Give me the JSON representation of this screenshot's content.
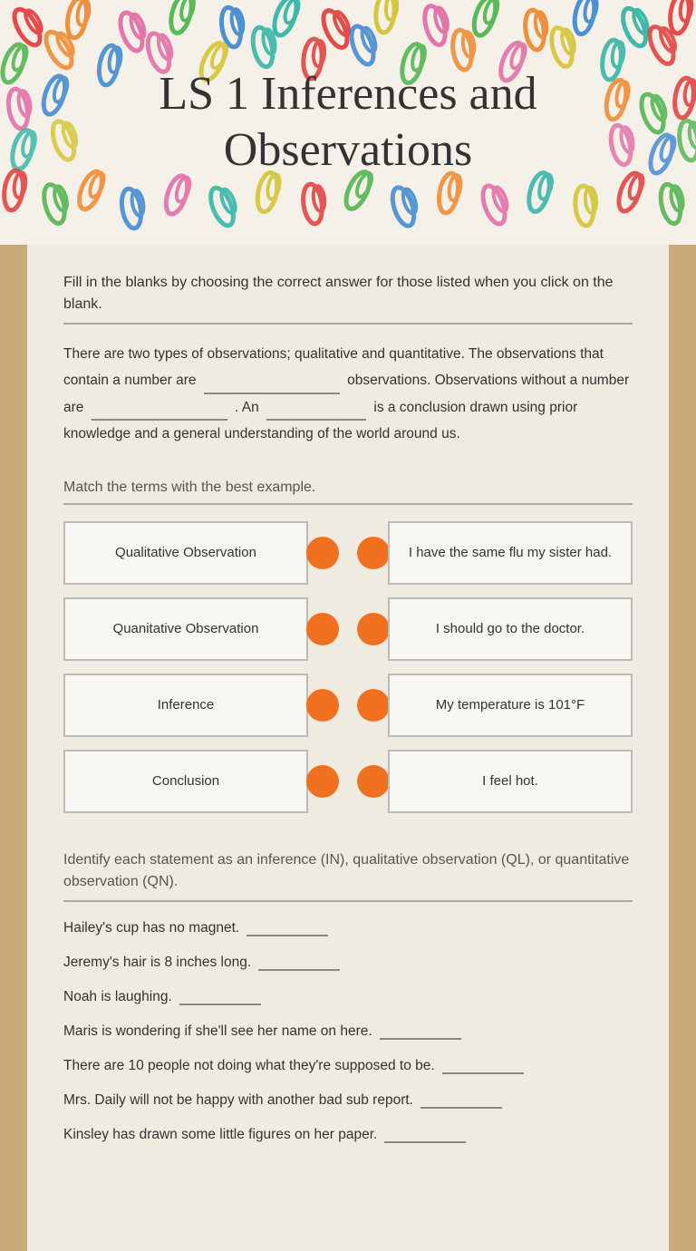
{
  "header": {
    "title": "LS 1 Inferences and Observations"
  },
  "section1": {
    "instructions": "Fill in the blanks by choosing the correct answer for those listed when you click on the blank.",
    "paragraph": "There are two types of observations; qualitative and quantitative. The observations that contain a number are",
    "part2": "observations. Observations without a number are",
    "part3": ". An",
    "part4": "is a conclusion drawn using prior knowledge and a general understanding of the world around us."
  },
  "section2": {
    "instructions": "Match the terms with the best example.",
    "left_items": [
      "Qualitative Observation",
      "Quanitative Observation",
      "Inference",
      "Conclusion"
    ],
    "right_items": [
      "I have the same flu my sister had.",
      "I should go to the doctor.",
      "My temperature is 101°F",
      "I feel hot."
    ]
  },
  "section3": {
    "instructions": "Identify each statement as an inference (IN), qualitative observation (QL), or quantitative observation (QN).",
    "items": [
      "Hailey's cup has no magnet.",
      "Jeremy's hair is 8 inches long.",
      "Noah is laughing.",
      "Maris is wondering if she'll see her name on here.",
      "There are 10 people not doing what they're supposed to be.",
      "Mrs. Daily will not be happy with another bad sub report.",
      "Kinsley has drawn some little figures on her paper."
    ]
  },
  "colors": {
    "accent": "#f07020",
    "background": "#f0ebe0",
    "outer": "#c8a97a"
  }
}
